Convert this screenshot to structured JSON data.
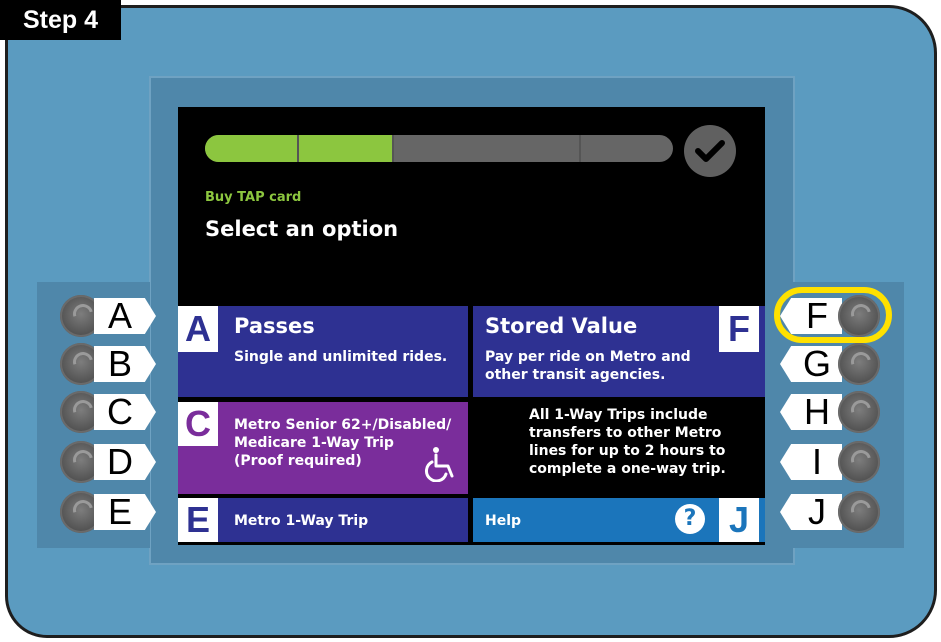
{
  "step_label": "Step 4",
  "progress": {
    "fraction": 0.4,
    "segments": 4
  },
  "header": {
    "subtitle": "Buy TAP card",
    "title": "Select an option"
  },
  "options": {
    "a": {
      "letter": "A",
      "title": "Passes",
      "desc": "Single and unlimited rides."
    },
    "f": {
      "letter": "F",
      "title": "Stored Value",
      "desc_1": "Pay per ride on Metro and",
      "desc_2": "other transit agencies."
    },
    "c": {
      "letter": "C",
      "line_1": "Metro Senior 62+/Disabled/",
      "line_2": "Medicare 1-Way Trip",
      "line_3": "(Proof required)"
    },
    "info": {
      "line_1": "All 1-Way Trips include",
      "line_2": "transfers to other Metro",
      "line_3": "lines for up to 2 hours to",
      "line_4": "complete a one-way trip."
    },
    "e": {
      "letter": "E",
      "label": "Metro 1-Way Trip"
    },
    "j": {
      "letter": "J",
      "label": "Help",
      "icon_text": "?"
    }
  },
  "buttons_left": [
    "A",
    "B",
    "C",
    "D",
    "E"
  ],
  "buttons_right": [
    "F",
    "G",
    "H",
    "I",
    "J"
  ],
  "highlighted_button": "F",
  "colors": {
    "kiosk": "#5b9bc0",
    "progress_green": "#8cc63f",
    "option_blue": "#2e3192",
    "option_purple": "#7a2d9b",
    "help_blue": "#1b75bb",
    "highlight": "#ffe100"
  }
}
